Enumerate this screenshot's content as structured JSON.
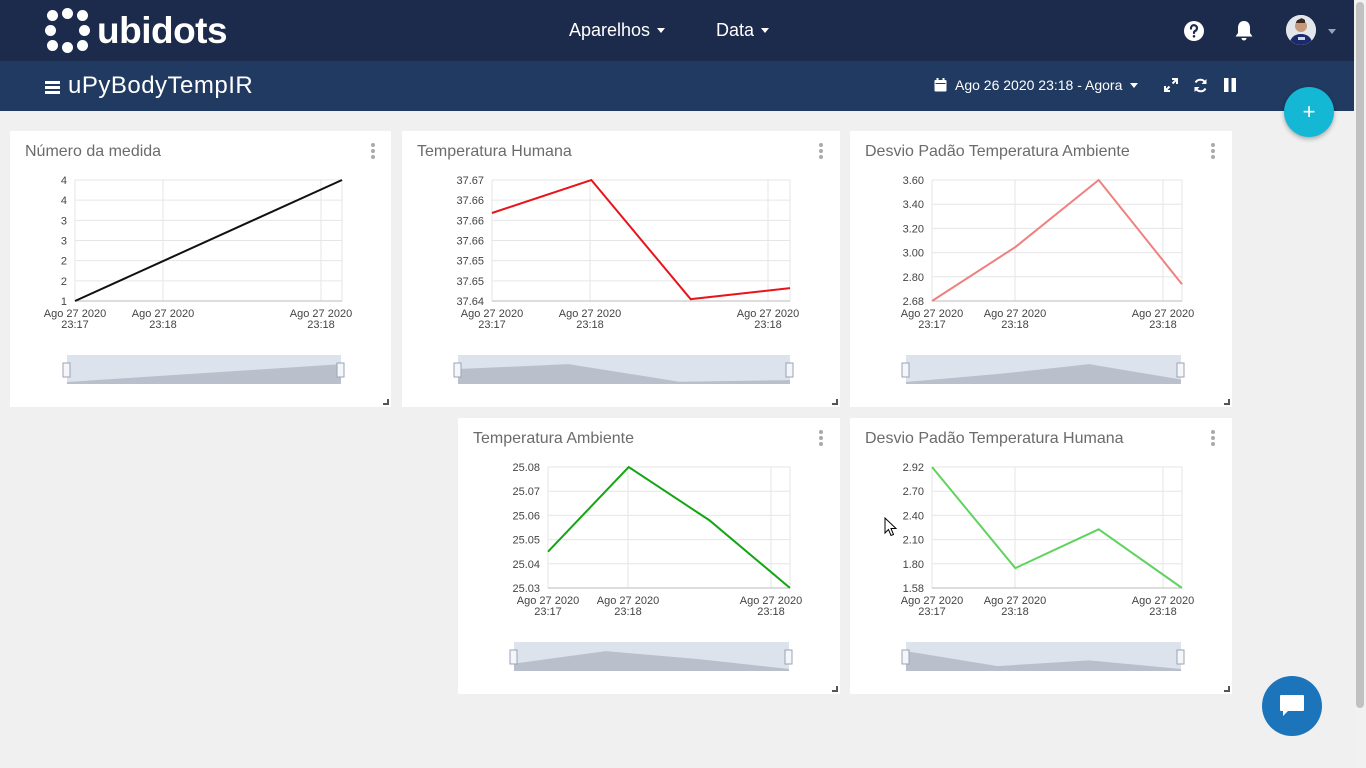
{
  "brand": {
    "name": "ubidots"
  },
  "nav": {
    "devices": "Aparelhos",
    "data": "Data"
  },
  "dashboard": {
    "title": "uPyBodyTempIR",
    "date_range": "Ago 26 2020 23:18 - Agora"
  },
  "icons": {
    "help": "question-circle-icon",
    "notifications": "bell-icon",
    "user": "user-avatar",
    "menu": "hamburger-icon",
    "calendar": "calendar-icon",
    "fullscreen": "expand-icon",
    "refresh": "refresh-icon",
    "pause": "pause-icon",
    "add": "plus-icon",
    "chat": "chat-bubble-icon"
  },
  "colors": {
    "topbar": "#1c2b4b",
    "subbar": "#203a61",
    "fab": "#14b8d4",
    "chat": "#1c74bb"
  },
  "fab_label": "+",
  "widgets": [
    {
      "title": "Número da medida",
      "chart_data": {
        "type": "line",
        "color": "#111111",
        "x": [
          "23:17:05",
          "23:17:35",
          "23:18:05",
          "23:18:35"
        ],
        "y": [
          1,
          2,
          3,
          4
        ],
        "ylim": [
          1,
          4
        ],
        "ytick_labels": [
          "4",
          "4",
          "3",
          "3",
          "2",
          "2",
          "1"
        ],
        "xtick_labels": [
          [
            "Ago 27 2020",
            "23:17"
          ],
          [
            "Ago 27 2020",
            "23:18"
          ],
          [
            "Ago 27 2020",
            "23:18"
          ]
        ]
      }
    },
    {
      "title": "Temperatura Humana",
      "chart_data": {
        "type": "line",
        "color": "#e8141c",
        "x": [
          "23:17:05",
          "23:17:35",
          "23:18:05",
          "23:18:35"
        ],
        "y": [
          37.663,
          37.672,
          37.6395,
          37.6425
        ],
        "ylim": [
          37.639,
          37.672
        ],
        "ytick_labels": [
          "37.67",
          "37.66",
          "37.66",
          "37.66",
          "37.65",
          "37.65",
          "37.64"
        ],
        "xtick_labels": [
          [
            "Ago 27 2020",
            "23:17"
          ],
          [
            "Ago 27 2020",
            "23:18"
          ],
          [
            "Ago 27 2020",
            "23:18"
          ]
        ]
      }
    },
    {
      "title": "Desvio Padão Temperatura Ambiente",
      "chart_data": {
        "type": "line",
        "color": "#f08080",
        "x": [
          "23:17:05",
          "23:17:35",
          "23:18:05",
          "23:18:35"
        ],
        "y": [
          2.68,
          3.13,
          3.69,
          2.82
        ],
        "ylim": [
          2.68,
          3.69
        ],
        "ytick_labels": [
          "3.60",
          "3.40",
          "3.20",
          "3.00",
          "2.80",
          "2.68"
        ],
        "xtick_labels": [
          [
            "Ago 27 2020",
            "23:17"
          ],
          [
            "Ago 27 2020",
            "23:18"
          ],
          [
            "Ago 27 2020",
            "23:18"
          ]
        ]
      }
    },
    {
      "title": "Temperatura Ambiente",
      "chart_data": {
        "type": "line",
        "color": "#14a514",
        "x": [
          "23:17:05",
          "23:17:35",
          "23:18:05",
          "23:18:35"
        ],
        "y": [
          25.045,
          25.08,
          25.058,
          25.03
        ],
        "ylim": [
          25.03,
          25.08
        ],
        "ytick_labels": [
          "25.08",
          "25.07",
          "25.06",
          "25.05",
          "25.04",
          "25.03"
        ],
        "xtick_labels": [
          [
            "Ago 27 2020",
            "23:17"
          ],
          [
            "Ago 27 2020",
            "23:18"
          ],
          [
            "Ago 27 2020",
            "23:18"
          ]
        ]
      }
    },
    {
      "title": "Desvio Padão Temperatura Humana",
      "chart_data": {
        "type": "line",
        "color": "#5fd35f",
        "x": [
          "23:17:05",
          "23:17:35",
          "23:18:05",
          "23:18:35"
        ],
        "y": [
          2.92,
          1.8,
          2.23,
          1.58
        ],
        "ylim": [
          1.58,
          2.92
        ],
        "ytick_labels": [
          "2.92",
          "2.70",
          "2.40",
          "2.10",
          "1.80",
          "1.58"
        ],
        "xtick_labels": [
          [
            "Ago 27 2020",
            "23:17"
          ],
          [
            "Ago 27 2020",
            "23:18"
          ],
          [
            "Ago 27 2020",
            "23:18"
          ]
        ]
      }
    }
  ]
}
